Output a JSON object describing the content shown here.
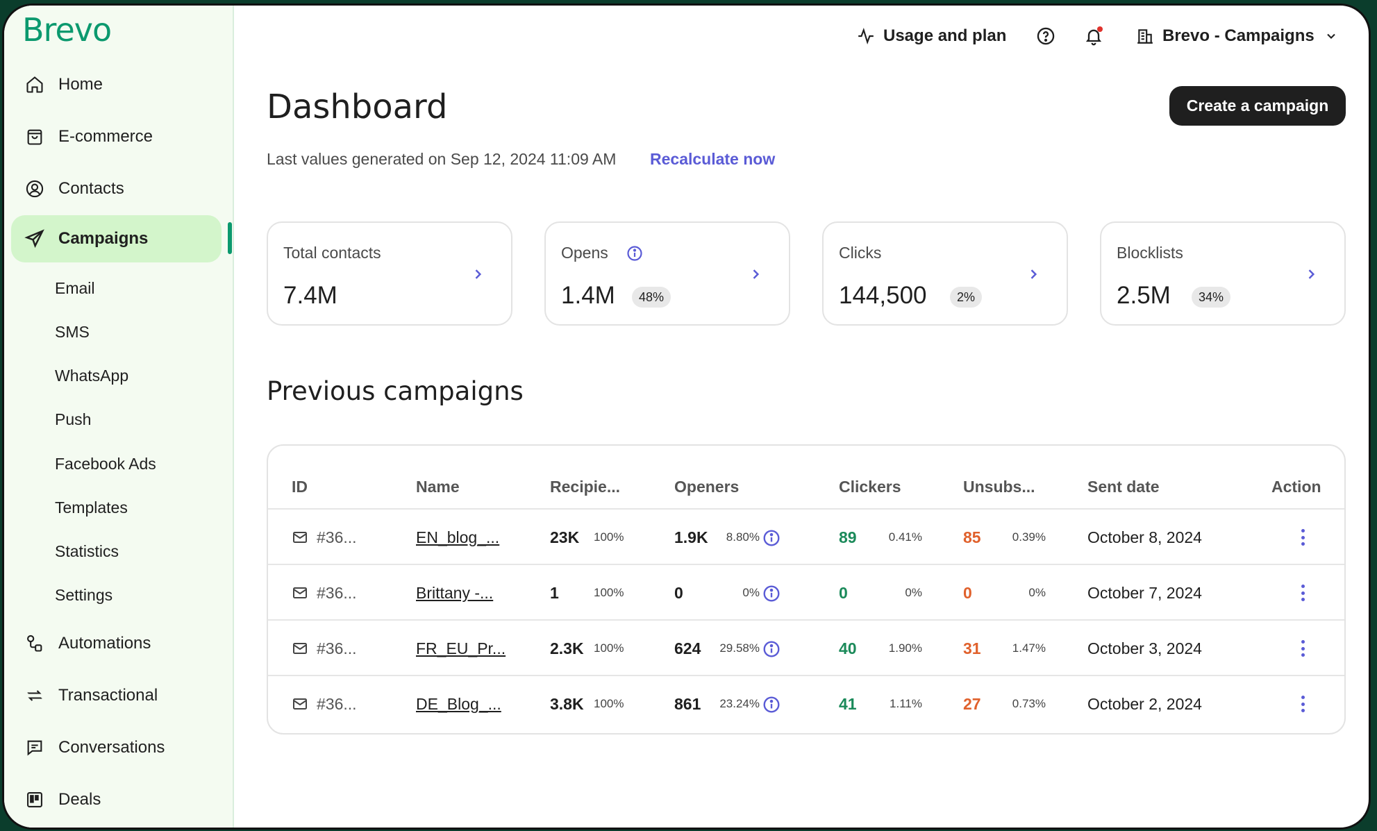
{
  "brand": {
    "logo": "Brevo",
    "accent": "#0b996e",
    "link_color": "#5a5bd6"
  },
  "sidebar": {
    "items": [
      {
        "label": "Home",
        "icon": "home-icon"
      },
      {
        "label": "E-commerce",
        "icon": "shopping-bag-icon"
      },
      {
        "label": "Contacts",
        "icon": "user-circle-icon"
      },
      {
        "label": "Campaigns",
        "icon": "send-icon",
        "active": true
      },
      {
        "label": "Automations",
        "icon": "automation-icon"
      },
      {
        "label": "Transactional",
        "icon": "transactional-icon"
      },
      {
        "label": "Conversations",
        "icon": "chat-icon"
      },
      {
        "label": "Deals",
        "icon": "deals-board-icon"
      }
    ],
    "sub_items": [
      "Email",
      "SMS",
      "WhatsApp",
      "Push",
      "Facebook Ads",
      "Templates",
      "Statistics",
      "Settings"
    ]
  },
  "header": {
    "usage_label": "Usage and plan",
    "account_label": "Brevo - Campaigns"
  },
  "main": {
    "title": "Dashboard",
    "create_label": "Create a campaign",
    "last_values": "Last values generated on Sep 12, 2024 11:09 AM",
    "recalculate": "Recalculate now",
    "stats": [
      {
        "label": "Total contacts",
        "value": "7.4M",
        "pct": ""
      },
      {
        "label": "Opens",
        "value": "1.4M",
        "pct": "48%"
      },
      {
        "label": "Clicks",
        "value": "144,500",
        "pct": "2%"
      },
      {
        "label": "Blocklists",
        "value": "2.5M",
        "pct": "34%"
      }
    ],
    "section_title": "Previous campaigns",
    "table": {
      "headers": [
        "ID",
        "Name",
        "Recipie...",
        "Openers",
        "Clickers",
        "Unsubs...",
        "Sent date",
        "Action"
      ],
      "rows": [
        {
          "id": "#36...",
          "name": "EN_blog_...",
          "recipients": "23K",
          "recipients_pct": "100%",
          "openers": "1.9K",
          "openers_pct": "8.80%",
          "clickers": "89",
          "clickers_pct": "0.41%",
          "unsubs": "85",
          "unsubs_pct": "0.39%",
          "date": "October 8, 2024"
        },
        {
          "id": "#36...",
          "name": "Brittany -...",
          "recipients": "1",
          "recipients_pct": "100%",
          "openers": "0",
          "openers_pct": "0%",
          "clickers": "0",
          "clickers_pct": "0%",
          "unsubs": "0",
          "unsubs_pct": "0%",
          "date": "October 7, 2024"
        },
        {
          "id": "#36...",
          "name": "FR_EU_Pr...",
          "recipients": "2.3K",
          "recipients_pct": "100%",
          "openers": "624",
          "openers_pct": "29.58%",
          "clickers": "40",
          "clickers_pct": "1.90%",
          "unsubs": "31",
          "unsubs_pct": "1.47%",
          "date": "October 3, 2024"
        },
        {
          "id": "#36...",
          "name": "DE_Blog_...",
          "recipients": "3.8K",
          "recipients_pct": "100%",
          "openers": "861",
          "openers_pct": "23.24%",
          "clickers": "41",
          "clickers_pct": "1.11%",
          "unsubs": "27",
          "unsubs_pct": "0.73%",
          "date": "October 2, 2024"
        }
      ]
    }
  }
}
